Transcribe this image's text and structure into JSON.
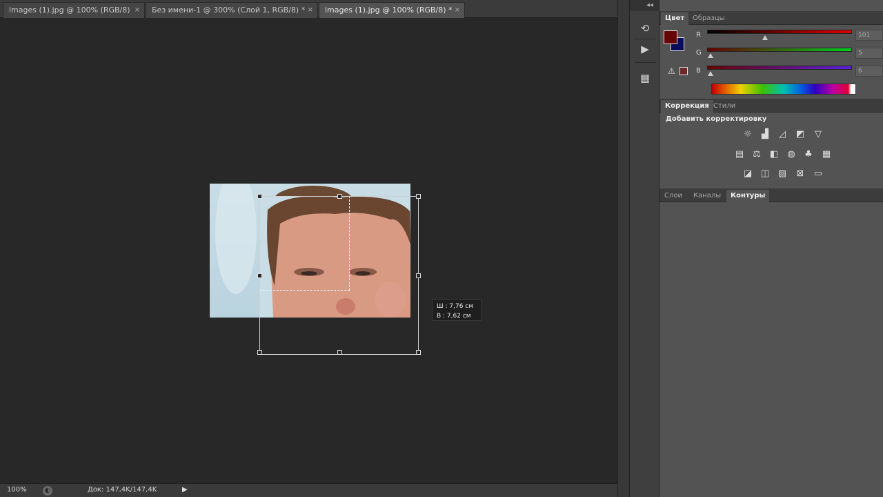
{
  "document_tabs": [
    {
      "label": "images (1).jpg @ 100% (RGB/8)",
      "close": "×",
      "active": false
    },
    {
      "label": "Без имени-1 @ 300% (Слой 1, RGB/8) *",
      "close": "×",
      "active": false
    },
    {
      "label": "images (1).jpg @ 100% (RGB/8) *",
      "close": "×",
      "active": true
    }
  ],
  "canvas": {
    "size_tooltip": {
      "width": "Ш : 7,76 см",
      "height": "В : 7,62 см"
    }
  },
  "status_bar": {
    "zoom": "100%",
    "doc_info": "Док: 147,4K/147,4K",
    "arrow": "▶"
  },
  "dock": {
    "collapse": "◂◂",
    "buttons": [
      "history-icon",
      "play-icon",
      "properties-icon"
    ]
  },
  "color_panel": {
    "tabs": [
      "Цвет",
      "Образцы"
    ],
    "active_tab": "Цвет",
    "foreground": "#650506",
    "background": "#0b0b5c",
    "channels": [
      {
        "label": "R",
        "value": "101",
        "fraction": 0.4
      },
      {
        "label": "G",
        "value": "5",
        "fraction": 0.02
      },
      {
        "label": "B",
        "value": "6",
        "fraction": 0.02
      }
    ]
  },
  "adjustments_panel": {
    "tabs": [
      "Коррекция",
      "Стили"
    ],
    "active_tab": "Коррекция",
    "title": "Добавить корректировку"
  },
  "layers_panel": {
    "tabs": [
      "Слои",
      "Каналы",
      "Контуры"
    ],
    "active_tab": "Контуры"
  }
}
